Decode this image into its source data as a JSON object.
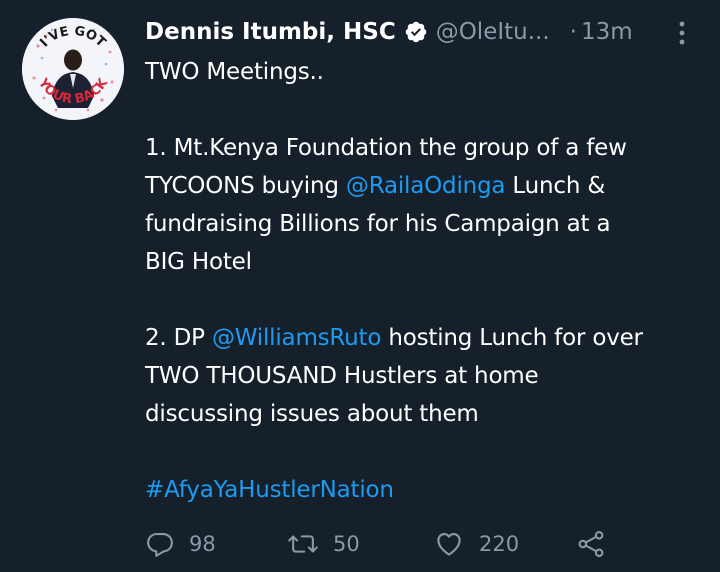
{
  "author": {
    "display_name": "Dennis Itumbi, HSC",
    "handle": "@OleItu...",
    "verified": true,
    "avatar_text_top": "I'VE GOT",
    "avatar_text_bottom": "YOUR BACK"
  },
  "meta": {
    "separator": "·",
    "time": "13m"
  },
  "tweet": {
    "lines": [
      [
        {
          "text": "TWO Meetings..",
          "type": "text"
        }
      ],
      [],
      [
        {
          "text": "1. Mt.Kenya Foundation the group of a few",
          "type": "text"
        }
      ],
      [
        {
          "text": "TYCOONS buying ",
          "type": "text"
        },
        {
          "text": "@RailaOdinga",
          "type": "mention"
        },
        {
          "text": " Lunch &",
          "type": "text"
        }
      ],
      [
        {
          "text": "fundraising Billions for his Campaign at a",
          "type": "text"
        }
      ],
      [
        {
          "text": "BIG Hotel",
          "type": "text"
        }
      ],
      [],
      [
        {
          "text": "2. DP ",
          "type": "text"
        },
        {
          "text": "@WilliamsRuto",
          "type": "mention"
        },
        {
          "text": " hosting Lunch for over",
          "type": "text"
        }
      ],
      [
        {
          "text": "TWO THOUSAND Hustlers at  home",
          "type": "text"
        }
      ],
      [
        {
          "text": "discussing issues about them",
          "type": "text"
        }
      ],
      [],
      [
        {
          "text": "#AfyaYaHustlerNation",
          "type": "hashtag"
        }
      ]
    ]
  },
  "actions": {
    "replies": "98",
    "retweets": "50",
    "likes": "220"
  },
  "colors": {
    "background": "#15202b",
    "text": "#ffffff",
    "secondary": "#8b98a5",
    "link": "#1d9bf0"
  },
  "icons": {
    "verified": "verified-badge-icon",
    "more": "more-vertical-icon",
    "reply": "reply-icon",
    "retweet": "retweet-icon",
    "like": "heart-icon",
    "share": "share-icon"
  }
}
